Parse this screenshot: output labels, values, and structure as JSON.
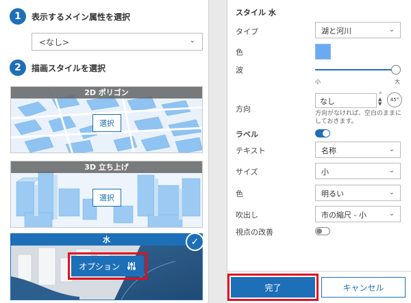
{
  "left": {
    "step1": {
      "number": "1",
      "title": "表示するメイン属性を選択"
    },
    "attribute_select": {
      "value": "<なし>"
    },
    "step2": {
      "number": "2",
      "title": "描画スタイルを選択"
    },
    "cards": [
      {
        "title": "2D ポリゴン",
        "button": "選択"
      },
      {
        "title": "3D 立ち上げ",
        "button": "選択"
      },
      {
        "title": "水",
        "button": "オプション"
      }
    ]
  },
  "right": {
    "title": "スタイル 水",
    "type": {
      "label": "タイプ",
      "value": "湖と河川"
    },
    "color": {
      "label": "色",
      "value": "#6aaaf2"
    },
    "wave": {
      "label": "波",
      "min_label": "小",
      "max_label": "大",
      "level": 1.0
    },
    "direction": {
      "label": "方向",
      "value": "なし",
      "unit": "°",
      "dial": "45°",
      "help": "方向がなければ、空白のままにしておきます。"
    },
    "labels": {
      "label": "ラベル",
      "on": true
    },
    "text": {
      "label": "テキスト",
      "value": "名称"
    },
    "size": {
      "label": "サイズ",
      "value": "小"
    },
    "label_color": {
      "label": "色",
      "value": "明るい"
    },
    "callout": {
      "label": "吹出し",
      "value": "市の縮尺 - 小"
    },
    "viewpoint": {
      "label": "視点の改善",
      "on": false
    },
    "done": "完了",
    "cancel": "キャンセル"
  },
  "colors": {
    "accent": "#1d6fb8",
    "highlight": "#e0101e",
    "water": "#6aaaf2"
  }
}
